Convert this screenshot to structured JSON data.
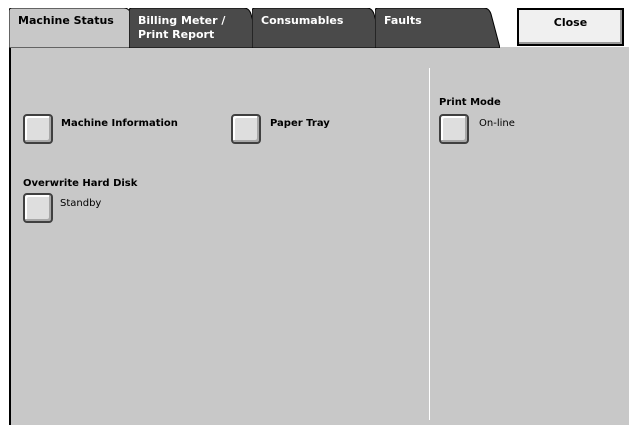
{
  "tabs": [
    {
      "label": "Machine Status"
    },
    {
      "label": "Billing Meter /\nPrint Report"
    },
    {
      "label": "Consumables"
    },
    {
      "label": "Faults"
    }
  ],
  "close_label": "Close",
  "left": {
    "machine_information_label": "Machine Information",
    "paper_tray_label": "Paper Tray",
    "overwrite_hard_disk_label": "Overwrite Hard Disk",
    "overwrite_hard_disk_value": "Standby"
  },
  "right": {
    "print_mode_label": "Print Mode",
    "print_mode_value": "On-line"
  },
  "colors": {
    "panel": "#c8c8c8",
    "tab_inactive": "#4a4a4a",
    "tab_active": "#c8c8c8"
  }
}
